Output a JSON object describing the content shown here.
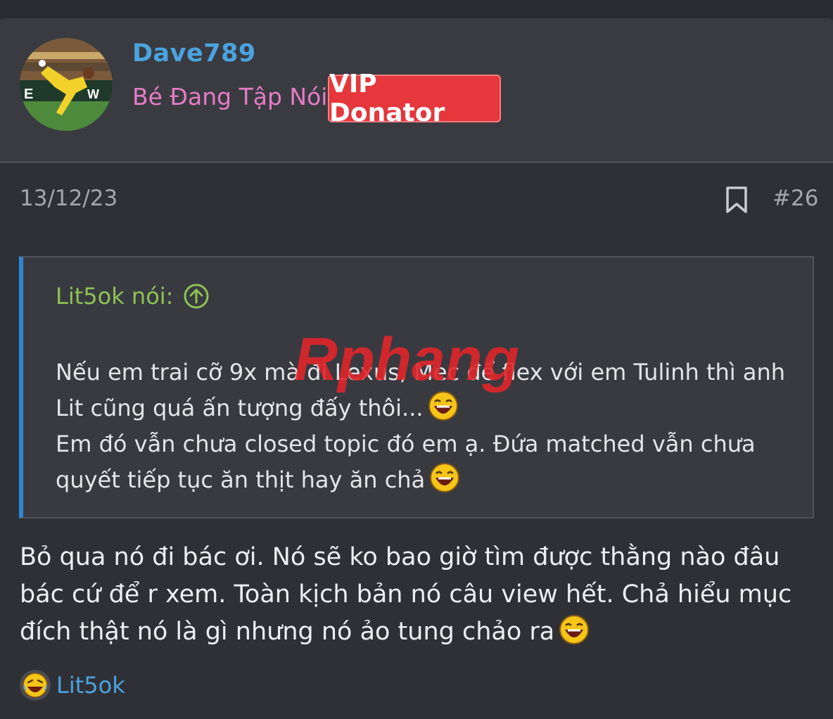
{
  "post": {
    "user": {
      "name": "Dave789",
      "title": "Bé Đang Tập Nói",
      "badge": "VIP Donator"
    },
    "date": "13/12/23",
    "number": "#26",
    "quote": {
      "author_label": "Lit5ok nói:",
      "line1": "Nếu em trai cỡ 9x mà đi Lexus, Mec để flex với em Tulinh thì anh",
      "line2": "Lit cũng quá ấn tượng đấy thôi...",
      "line3": "Em đó vẫn chưa closed topic đó em ạ. Đứa matched vẫn chưa",
      "line4": "quyết tiếp tục ăn thịt hay ăn chả"
    },
    "body": {
      "line1": "Bỏ qua nó đi bác ơi. Nó sẽ ko bao giờ tìm được thằng nào đâu",
      "line2": "bác cứ để r xem. Toàn kịch bản nó câu view hết. Chả hiểu mục",
      "line3": "đích thật nó là gì nhưng nó ảo tung chảo ra"
    },
    "reaction": {
      "icon": "laughing-crying-emoji-icon",
      "user": "Lit5ok"
    },
    "watermark_text": "Rphang"
  },
  "colors": {
    "background": "#2f3036",
    "header": "#393b41",
    "username": "#4aa3df",
    "user_title": "#e67cc6",
    "badge": "#e5373c",
    "quote_bar": "#2e86d6",
    "quote_author": "#8ec255"
  }
}
